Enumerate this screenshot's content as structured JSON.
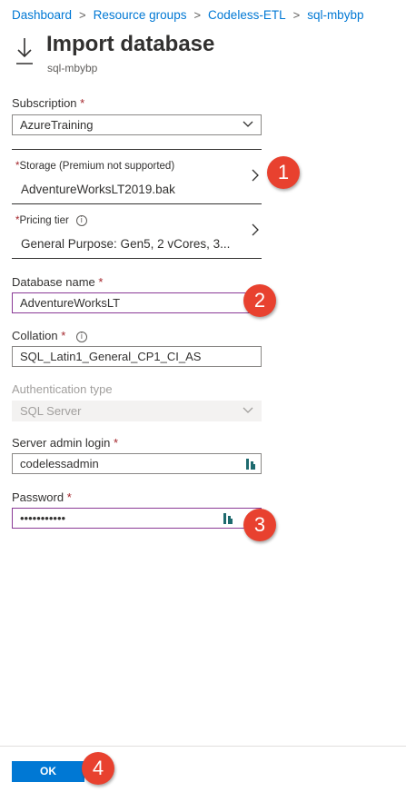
{
  "breadcrumb": [
    "Dashboard",
    "Resource groups",
    "Codeless-ETL",
    "sql-mbybp"
  ],
  "page": {
    "title": "Import database",
    "subtitle": "sql-mbybp"
  },
  "form": {
    "subscription": {
      "label": "Subscription",
      "required": "*",
      "value": "AzureTraining"
    },
    "storage": {
      "required": "*",
      "label": "Storage (Premium not supported)",
      "value": "AdventureWorksLT2019.bak"
    },
    "pricing_tier": {
      "required": "*",
      "label": "Pricing tier",
      "value": "General Purpose: Gen5, 2 vCores, 3..."
    },
    "database_name": {
      "label": "Database name",
      "required": "*",
      "value": "AdventureWorksLT"
    },
    "collation": {
      "label": "Collation",
      "required": "*",
      "value": "SQL_Latin1_General_CP1_CI_AS"
    },
    "authentication_type": {
      "label": "Authentication type",
      "value": "SQL Server"
    },
    "server_admin_login": {
      "label": "Server admin login",
      "required": "*",
      "value": "codelessadmin"
    },
    "password": {
      "label": "Password",
      "required": "*",
      "value": "•••••••••••"
    }
  },
  "badges": [
    "1",
    "2",
    "3",
    "4"
  ],
  "footer": {
    "ok_label": "OK"
  },
  "colors": {
    "accent": "#0078d4",
    "required": "#a4262c",
    "focus_border": "#8a3a96",
    "badge": "#e8412f"
  },
  "icons": {
    "header": "import-arrow-icon",
    "info": "info-icon",
    "dropdown": "chevron-down-icon",
    "picker": "chevron-right-icon",
    "key": "key-vault-icon"
  }
}
